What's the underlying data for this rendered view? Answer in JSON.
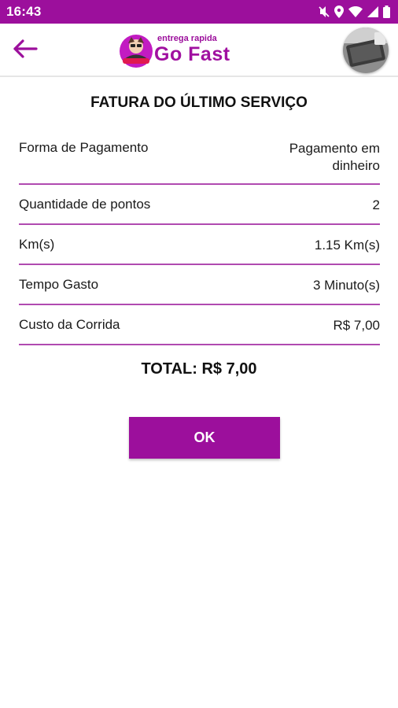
{
  "status_bar": {
    "time": "16:43",
    "icons": [
      "mute-icon",
      "location-icon",
      "wifi-icon",
      "signal-icon",
      "battery-icon"
    ]
  },
  "header": {
    "back_icon": "arrow-left-icon",
    "logo": {
      "tagline": "entrega rapida",
      "name": "Go Fast"
    },
    "avatar": "profile-avatar"
  },
  "invoice": {
    "title": "FATURA DO ÚLTIMO SERVIÇO",
    "rows": [
      {
        "label": "Forma de Pagamento",
        "value_line1": "Pagamento em",
        "value_line2": "dinheiro"
      },
      {
        "label": "Quantidade de pontos",
        "value": "2"
      },
      {
        "label": "Km(s)",
        "value": "1.15 Km(s)"
      },
      {
        "label": "Tempo Gasto",
        "value": "3 Minuto(s)"
      },
      {
        "label": "Custo da Corrida",
        "value": "R$ 7,00"
      }
    ],
    "total": "TOTAL: R$ 7,00",
    "ok_label": "OK"
  },
  "colors": {
    "primary": "#9c0f9c",
    "divider": "#b04ab0"
  }
}
